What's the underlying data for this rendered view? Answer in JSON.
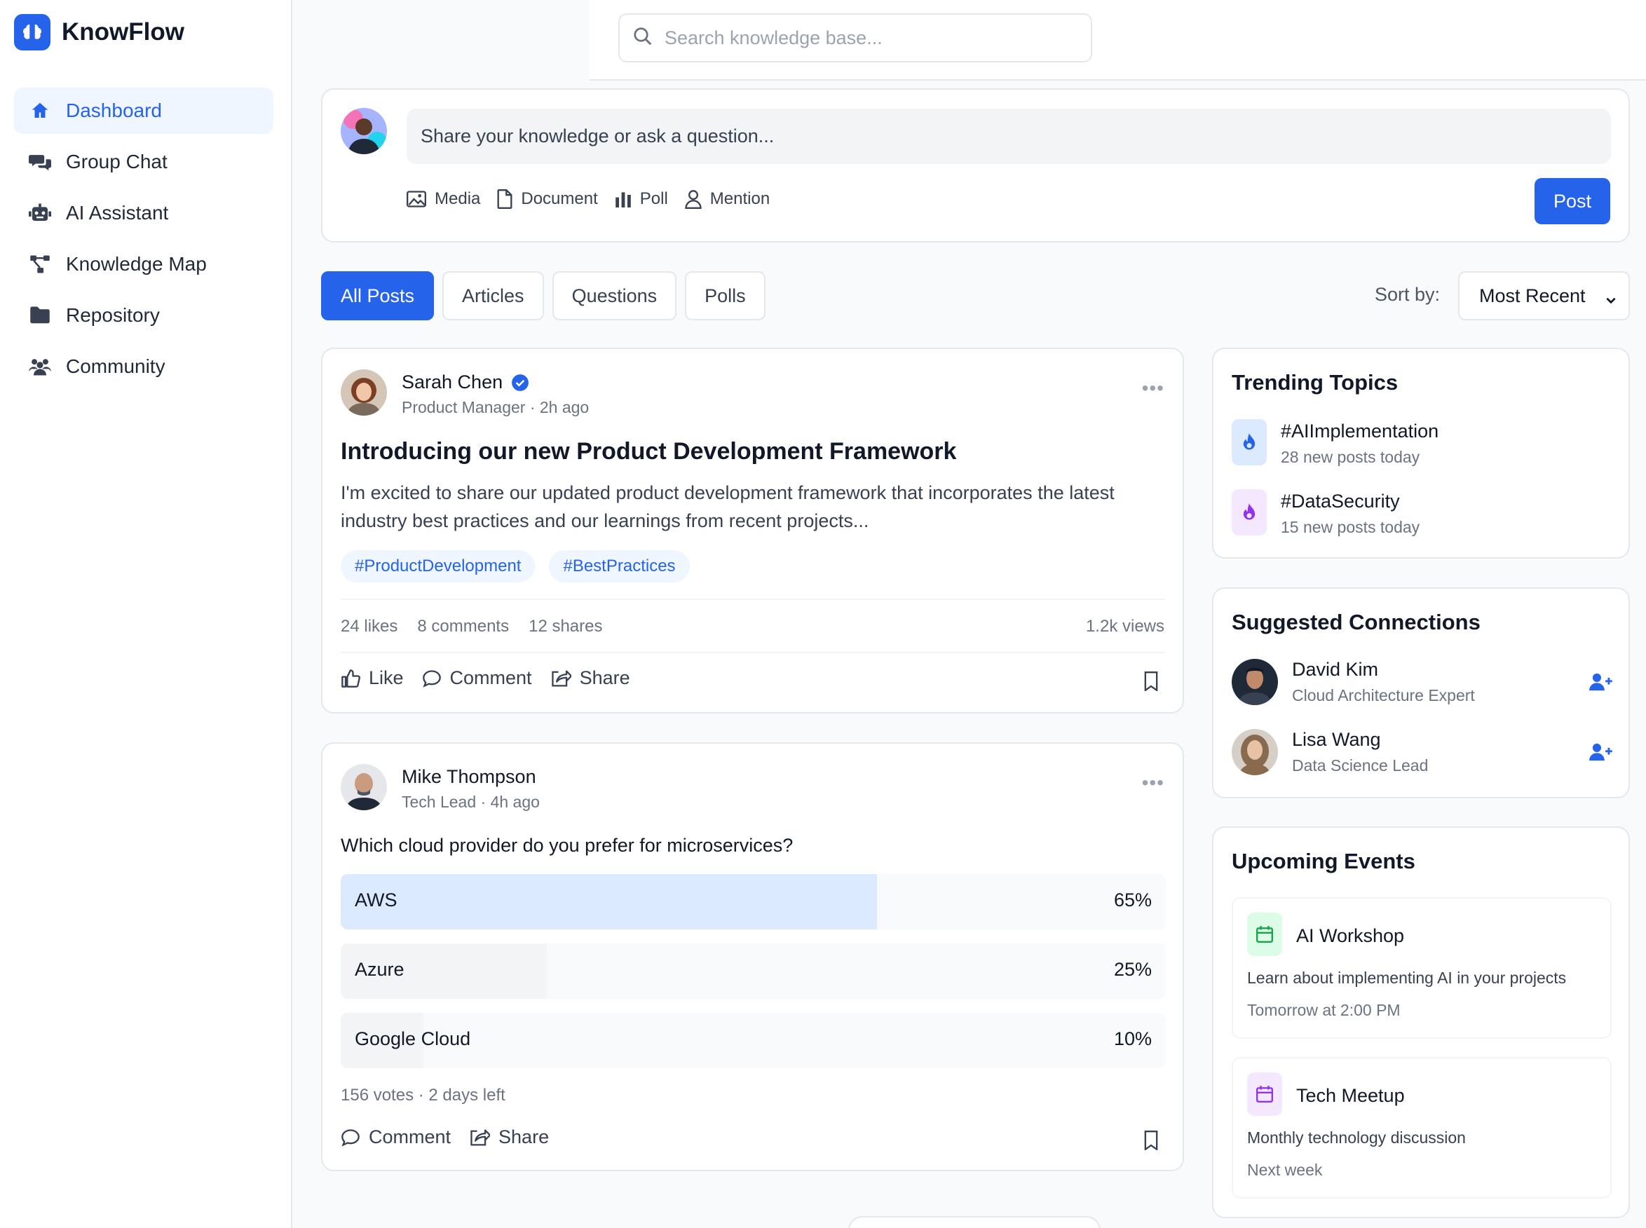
{
  "app": {
    "name": "KnowFlow"
  },
  "sidebar": {
    "items": [
      {
        "label": "Dashboard",
        "icon": "home-icon"
      },
      {
        "label": "Group Chat",
        "icon": "chat-bubbles-icon"
      },
      {
        "label": "AI Assistant",
        "icon": "robot-icon"
      },
      {
        "label": "Knowledge Map",
        "icon": "network-icon"
      },
      {
        "label": "Repository",
        "icon": "folder-icon"
      },
      {
        "label": "Community",
        "icon": "users-icon"
      }
    ]
  },
  "search": {
    "placeholder": "Search knowledge base..."
  },
  "composer": {
    "placeholder": "Share your knowledge or ask a question...",
    "tools": [
      "Media",
      "Document",
      "Poll",
      "Mention"
    ],
    "post_label": "Post"
  },
  "filters": {
    "tabs": [
      "All Posts",
      "Articles",
      "Questions",
      "Polls"
    ],
    "sort_label": "Sort by:",
    "sort_value": "Most Recent"
  },
  "posts": [
    {
      "author": "Sarah Chen",
      "meta": "Product Manager · 2h ago",
      "title": "Introducing our new Product Development Framework",
      "body": "I'm excited to share our updated product development framework that incorporates the latest industry best practices and our learnings from recent projects...",
      "tags": [
        "#ProductDevelopment",
        "#BestPractices"
      ],
      "likes": "24 likes",
      "comments": "8 comments",
      "shares": "12 shares",
      "views": "1.2k views",
      "actions": [
        "Like",
        "Comment",
        "Share"
      ]
    },
    {
      "author": "Mike Thompson",
      "meta": "Tech Lead · 4h ago",
      "question": "Which cloud provider do you prefer for microservices?",
      "options": [
        {
          "label": "AWS",
          "pct": "65%",
          "value": 0.65
        },
        {
          "label": "Azure",
          "pct": "25%",
          "value": 0.25
        },
        {
          "label": "Google Cloud",
          "pct": "10%",
          "value": 0.1
        }
      ],
      "poll_meta": "156 votes · 2 days left",
      "actions": [
        "Comment",
        "Share"
      ]
    }
  ],
  "trending": {
    "title": "Trending Topics",
    "topics": [
      {
        "name": "#AIImplementation",
        "sub": "28 new posts today",
        "color": "#2563eb",
        "bg": "#dbeafe"
      },
      {
        "name": "#DataSecurity",
        "sub": "15 new posts today",
        "color": "#9333ea",
        "bg": "#f3e8ff"
      }
    ]
  },
  "suggested": {
    "title": "Suggested Connections",
    "people": [
      {
        "name": "David Kim",
        "role": "Cloud Architecture Expert"
      },
      {
        "name": "Lisa Wang",
        "role": "Data Science Lead"
      }
    ]
  },
  "events": {
    "title": "Upcoming Events",
    "items": [
      {
        "title": "AI Workshop",
        "desc": "Learn about implementing AI in your projects",
        "time": "Tomorrow at 2:00 PM",
        "color": "#16a34a",
        "bg": "#dcfce7"
      },
      {
        "title": "Tech Meetup",
        "desc": "Monthly technology discussion",
        "time": "Next week",
        "color": "#9333ea",
        "bg": "#f3e8ff"
      }
    ]
  },
  "colors": {
    "accent": "#2563eb",
    "border": "#e5e7eb"
  }
}
